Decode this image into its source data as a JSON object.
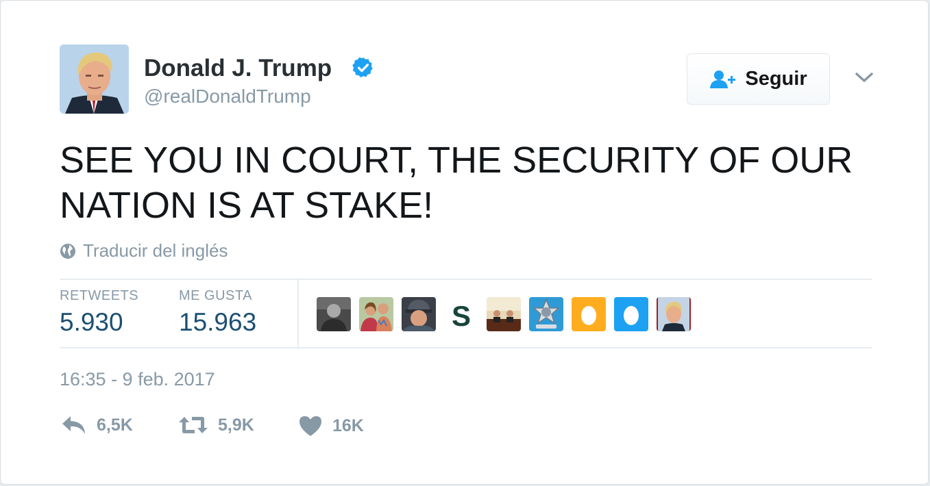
{
  "author": {
    "name": "Donald J. Trump",
    "handle": "@realDonaldTrump",
    "verified": true
  },
  "follow_button": {
    "label": "Seguir",
    "icon": "add-user-icon"
  },
  "tweet": {
    "text": "SEE YOU IN COURT, THE SECURITY OF OUR NATION IS AT STAKE!",
    "translate_label": "Traducir del inglés"
  },
  "stats": {
    "retweets_label": "RETWEETS",
    "retweets_value": "5.930",
    "likes_label": "ME GUSTA",
    "likes_value": "15.963"
  },
  "likers": [
    "liker-avatar-1",
    "liker-avatar-2",
    "liker-avatar-3",
    "liker-avatar-4",
    "liker-avatar-5",
    "liker-avatar-6",
    "liker-avatar-7",
    "liker-avatar-8",
    "liker-avatar-9"
  ],
  "timestamp": "16:35 - 9 feb. 2017",
  "actions": {
    "reply_count": "6,5K",
    "retweet_count": "5,9K",
    "like_count": "16K"
  },
  "colors": {
    "verified_blue": "#1da1f2",
    "text_dark": "#14171a",
    "muted": "#8899a6",
    "stat_value": "#1b4f72",
    "egg_orange": "#ffad1f",
    "egg_blue": "#1da1f2"
  }
}
